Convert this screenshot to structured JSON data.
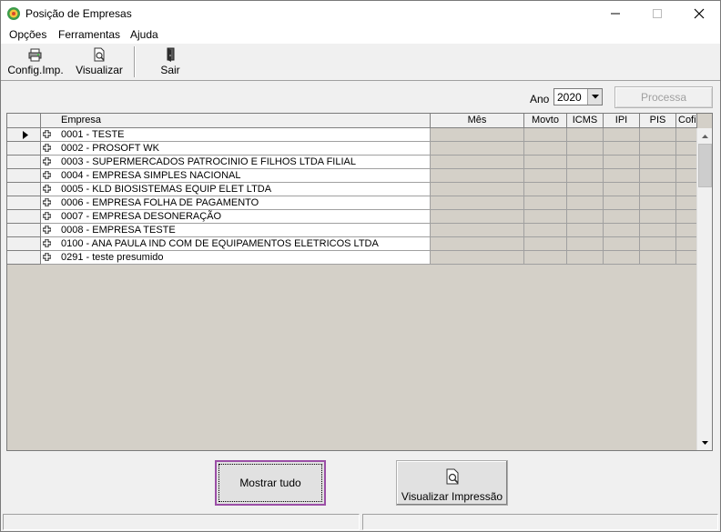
{
  "window": {
    "title": "Posição de Empresas"
  },
  "menu": {
    "items": [
      "Opções",
      "Ferramentas",
      "Ajuda"
    ]
  },
  "toolbar": {
    "buttons": [
      {
        "label": "Config.Imp.",
        "icon": "printer-config-icon"
      },
      {
        "label": "Visualizar",
        "icon": "print-preview-icon"
      },
      {
        "label": "Sair",
        "icon": "exit-door-icon"
      }
    ]
  },
  "filter": {
    "ano_label": "Ano",
    "ano_value": "2020",
    "processa_label": "Processa"
  },
  "grid": {
    "headers": {
      "empresa": "Empresa",
      "mes": "Mês",
      "movto": "Movto",
      "icms": "ICMS",
      "ipi": "IPI",
      "pis": "PIS",
      "cofins": "Cofi"
    },
    "rows": [
      "0001 - TESTE",
      "0002 - PROSOFT WK",
      "0003 - SUPERMERCADOS PATROCINIO E FILHOS LTDA FILIAL",
      "0004 - EMPRESA SIMPLES NACIONAL",
      "0005 - KLD BIOSISTEMAS EQUIP ELET LTDA",
      "0006 - EMPRESA FOLHA DE PAGAMENTO",
      "0007 - EMPRESA DESONERAÇÃO",
      "0008 - EMPRESA TESTE",
      "0100 - ANA PAULA IND COM DE EQUIPAMENTOS ELETRICOS LTDA",
      "0291 - teste presumido"
    ]
  },
  "buttons": {
    "mostrar_tudo": "Mostrar tudo",
    "visualizar_impressao": "Visualizar Impressão"
  },
  "colors": {
    "accent_outline": "#9b4fa6",
    "grid_background": "#d4d0c8"
  }
}
